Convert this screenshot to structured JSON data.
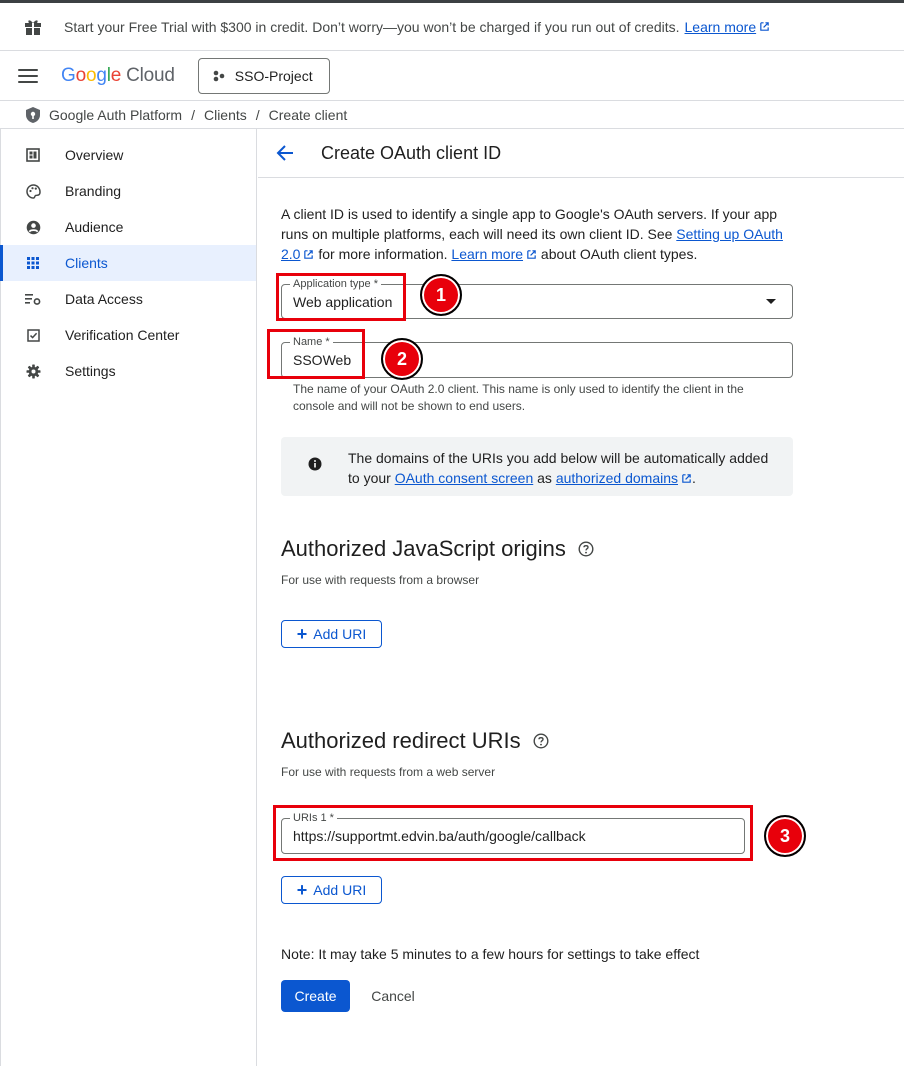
{
  "banner": {
    "text": "Start your Free Trial with $300 in credit. Don’t worry—you won’t be charged if you run out of credits.",
    "link": "Learn more"
  },
  "header": {
    "logo_google": "Google",
    "logo_cloud": "Cloud",
    "project": "SSO-Project"
  },
  "breadcrumb": [
    "Google Auth Platform",
    "Clients",
    "Create client"
  ],
  "sidebar": {
    "items": [
      {
        "label": "Overview",
        "icon": "dashboard-icon"
      },
      {
        "label": "Branding",
        "icon": "palette-icon"
      },
      {
        "label": "Audience",
        "icon": "person-icon"
      },
      {
        "label": "Clients",
        "icon": "grid-icon",
        "active": true
      },
      {
        "label": "Data Access",
        "icon": "data-settings-icon"
      },
      {
        "label": "Verification Center",
        "icon": "checkbox-icon"
      },
      {
        "label": "Settings",
        "icon": "gear-icon"
      }
    ]
  },
  "main": {
    "title": "Create OAuth client ID",
    "intro_1": "A client ID is used to identify a single app to Google's OAuth servers. If your app runs on multiple platforms, each will need its own client ID. See",
    "intro_link_1": "Setting up OAuth 2.0",
    "intro_2": "for more information.",
    "intro_link_2": "Learn more",
    "intro_3": "about OAuth client types.",
    "app_type_label": "Application type *",
    "app_type_value": "Web application",
    "name_label": "Name *",
    "name_value": "SSOWeb",
    "name_hint": "The name of your OAuth 2.0 client. This name is only used to identify the client in the console and will not be shown to end users.",
    "info_1": "The domains of the URIs you add below will be automatically added to your",
    "info_link_1": "OAuth consent screen",
    "info_2": "as",
    "info_link_2": "authorized domains",
    "info_3": ".",
    "js_origins_title": "Authorized JavaScript origins",
    "js_origins_sub": "For use with requests from a browser",
    "add_uri": "Add URI",
    "redirect_title": "Authorized redirect URIs",
    "redirect_sub": "For use with requests from a web server",
    "uri_label": "URIs 1 *",
    "uri_value": "https://supportmt.edvin.ba/auth/google/callback",
    "note": "Note: It may take 5 minutes to a few hours for settings to take effect",
    "create": "Create",
    "cancel": "Cancel"
  },
  "annotations": [
    "1",
    "2",
    "3"
  ],
  "colors": {
    "accent": "#0b57d0",
    "annotation": "#e8000b"
  }
}
